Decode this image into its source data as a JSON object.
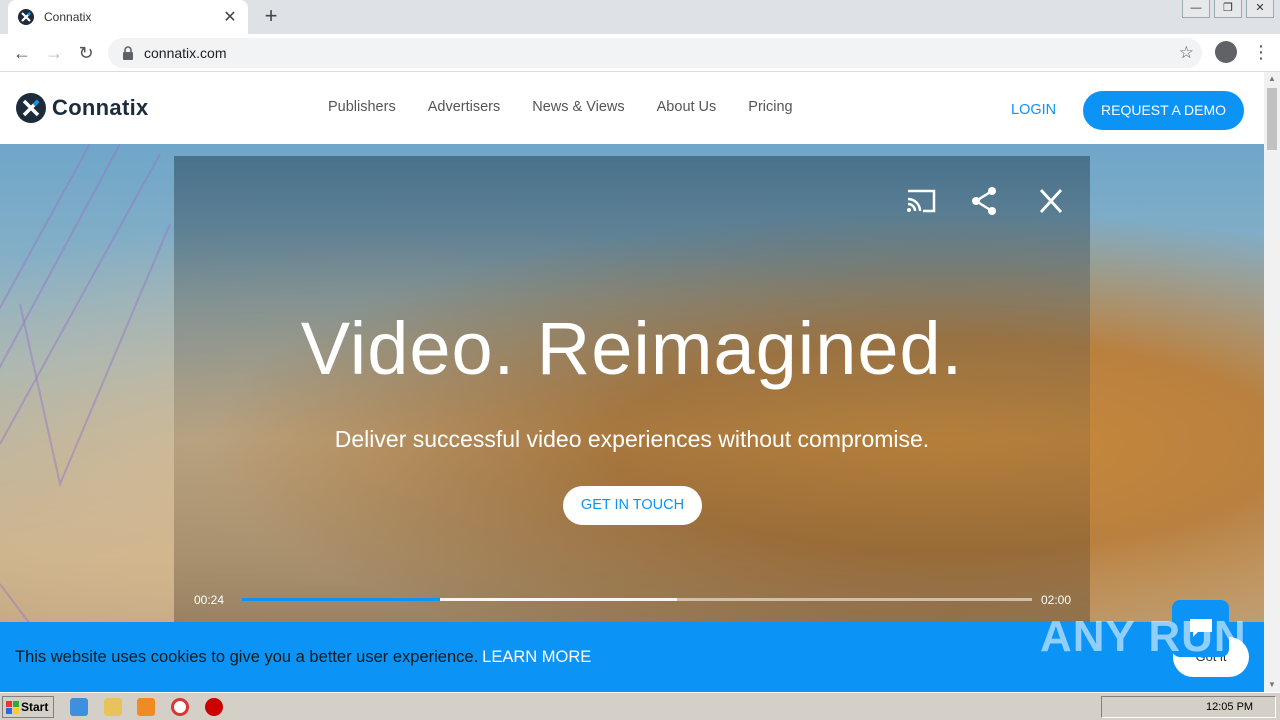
{
  "browser": {
    "tab_title": "Connatix",
    "tab_close": "✕",
    "new_tab": "+",
    "url": "connatix.com",
    "win_controls": [
      "—",
      "❐",
      "✕"
    ]
  },
  "site": {
    "logo_text": "Connatix",
    "nav": [
      "Publishers",
      "Advertisers",
      "News & Views",
      "About Us",
      "Pricing"
    ],
    "login": "LOGIN",
    "request_demo": "REQUEST A DEMO"
  },
  "hero": {
    "headline": "Video. Reimagined.",
    "subline": "Deliver successful video experiences without compromise.",
    "cta": "GET IN TOUCH",
    "player": {
      "current_time": "00:24",
      "duration": "02:00",
      "played_fraction": 0.25,
      "buffered_fraction": 0.55
    }
  },
  "cookie_bar": {
    "message": "This website uses cookies to give you a better user experience.",
    "learn_more": "LEARN MORE",
    "got_it": "Got it"
  },
  "watermark": "ANY RUN",
  "taskbar": {
    "start": "Start",
    "clock": "12:05 PM"
  },
  "colors": {
    "accent": "#0b93f6",
    "logo_dark": "#1d2b3a"
  }
}
